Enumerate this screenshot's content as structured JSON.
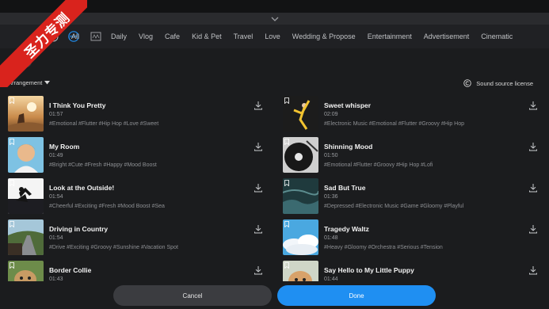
{
  "watermark": "圣力专测",
  "tabs": {
    "new_badge": "NEW",
    "items": [
      "All",
      "Daily",
      "Vlog",
      "Cafe",
      "Kid & Pet",
      "Travel",
      "Love",
      "Wedding & Propose",
      "Entertainment",
      "Advertisement",
      "Cinematic"
    ]
  },
  "toolbar": {
    "arrangement_label": "Arrangement",
    "license_label": "Sound source license"
  },
  "left_tracks": [
    {
      "title": "I Think You Pretty",
      "duration": "01:57",
      "tags": "#Emotional #Flutter #Hip Hop #Love #Sweet",
      "thumb": "sunset"
    },
    {
      "title": "My Room",
      "duration": "01:49",
      "tags": "#Bright #Cute #Fresh #Happy #Mood Boost",
      "thumb": "kid"
    },
    {
      "title": "Look at the Outside!",
      "duration": "01:54",
      "tags": "#Cheerful #Exciting #Fresh #Mood Boost #Sea",
      "thumb": "beach"
    },
    {
      "title": "Driving in Country",
      "duration": "01:54",
      "tags": "#Drive #Exciting #Groovy #Sunshine #Vacation Spot",
      "thumb": "road"
    },
    {
      "title": "Border Collie",
      "duration": "01:43",
      "tags": "",
      "thumb": "dog"
    }
  ],
  "right_tracks": [
    {
      "title": "Sweet whisper",
      "duration": "02:09",
      "tags": "#Electronic Music #Emotional #Flutter #Groovy #Hip Hop",
      "thumb": "dancer"
    },
    {
      "title": "Shinning Mood",
      "duration": "01:50",
      "tags": "#Emotional #Flutter #Groovy #Hip Hop #Lofi",
      "thumb": "vinyl"
    },
    {
      "title": "Sad But True",
      "duration": "01:36",
      "tags": "#Depressed #Electronic Music #Game #Gloomy #Playful",
      "thumb": "sea"
    },
    {
      "title": "Tragedy Waltz",
      "duration": "01:48",
      "tags": "#Heavy #Gloomy #Orchestra #Serious #Tension",
      "thumb": "clouds"
    },
    {
      "title": "Say Hello to My Little Puppy",
      "duration": "01:44",
      "tags": "",
      "thumb": "puppy"
    }
  ],
  "footer": {
    "cancel_label": "Cancel",
    "done_label": "Done"
  },
  "colors": {
    "accent": "#1f8ff2",
    "background": "#1b1c1e",
    "watermark": "#d9231d"
  }
}
